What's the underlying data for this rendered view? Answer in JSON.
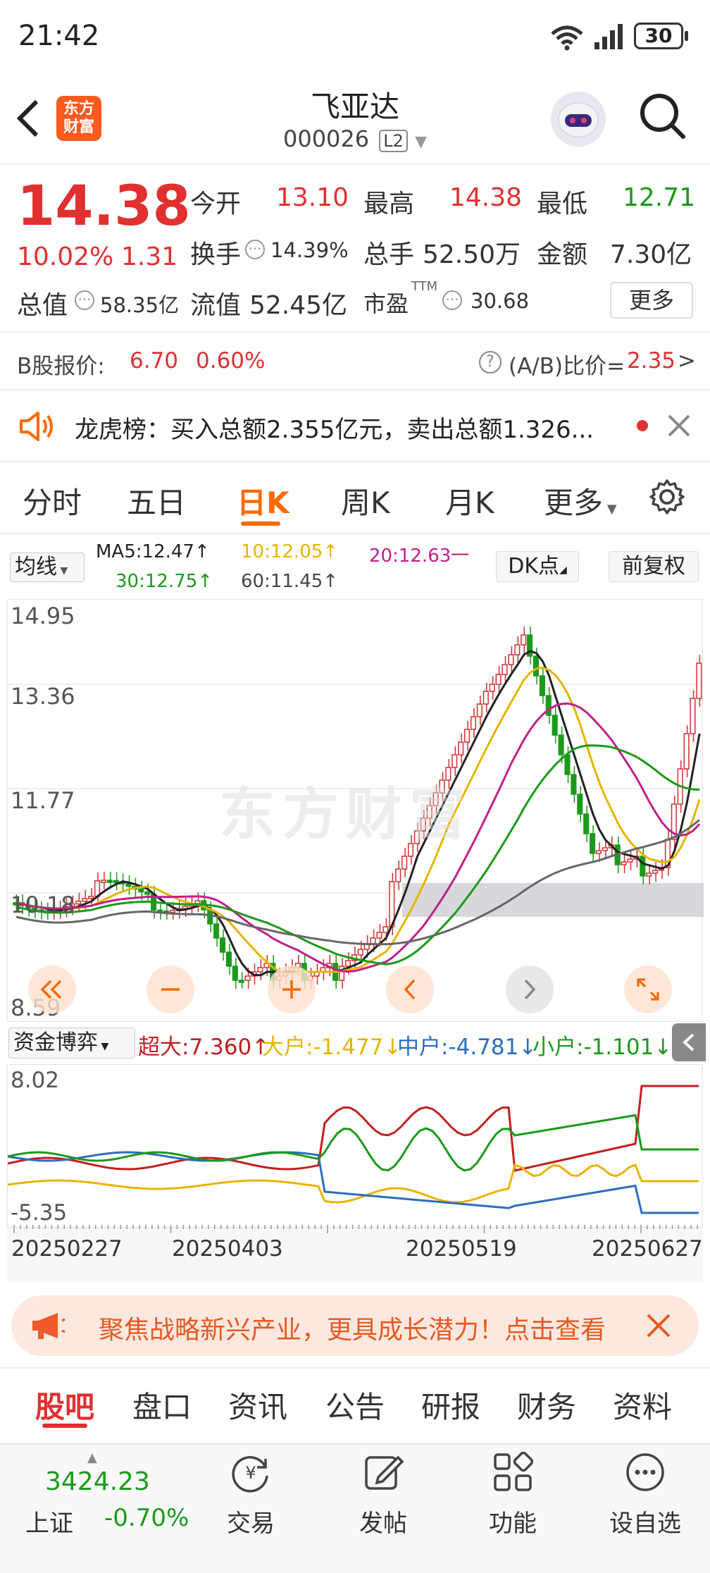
{
  "status": {
    "time": "21:42",
    "battery": "30"
  },
  "header": {
    "name": "飞亚达",
    "code": "000026",
    "level": "L2",
    "logo_top": "东方",
    "logo_bottom": "财富"
  },
  "quote": {
    "price": "14.38",
    "pct": "10.02%",
    "chg": "1.31",
    "open_label": "今开",
    "open": "13.10",
    "high_label": "最高",
    "high": "14.38",
    "low_label": "最低",
    "low": "12.71",
    "turnover_label": "换手",
    "turnover": "14.39%",
    "vol_label": "总手",
    "vol": "52.50万",
    "amt_label": "金额",
    "amt": "7.30亿",
    "mcap_label": "总值",
    "mcap": "58.35亿",
    "float_label": "流值",
    "float": "52.45亿",
    "pe_label": "市盈",
    "pe_sup": "TTM",
    "pe": "30.68",
    "more": "更多"
  },
  "bshare": {
    "label": "B股报价:",
    "price": "6.70",
    "pct": "0.60%",
    "ratio_label": "(A/B)比价=",
    "ratio": "2.35",
    "arrow": ">"
  },
  "notice": {
    "text": "龙虎榜：买入总额2.355亿元，卖出总额1.326..."
  },
  "tabs": [
    "分时",
    "五日",
    "日K",
    "周K",
    "月K",
    "更多"
  ],
  "ma": {
    "selector": "均线",
    "ma5": "MA5:12.47↑",
    "ma10": "10:12.05↑",
    "ma20": "20:12.63一",
    "ma30": "30:12.75↑",
    "ma60": "60:11.45↑",
    "dk": "DK点",
    "adj": "前复权"
  },
  "axis": {
    "y1": "14.95",
    "y2": "13.36",
    "y3": "11.77",
    "y4": "10.18",
    "y5": "8.59",
    "f_top": "8.02",
    "f_bot": "-5.35",
    "d1": "20250227",
    "d2": "20250403",
    "d3": "20250519",
    "d4": "20250627"
  },
  "fund": {
    "selector": "资金博弈",
    "super": "超大:7.360↑",
    "large": "大户:-1.477↓",
    "mid": "中户:-4.781↓",
    "small": "小户:-1.101↓"
  },
  "watermark": "东方财富",
  "promo": {
    "text": "聚焦战略新兴产业，更具成长潜力！点击查看"
  },
  "bottom_tabs": [
    "股吧",
    "盘口",
    "资讯",
    "公告",
    "研报",
    "财务",
    "资料"
  ],
  "nav": {
    "index_value": "3424.23",
    "index_name": "上证",
    "index_pct": "-0.70%",
    "trade": "交易",
    "post": "发帖",
    "func": "功能",
    "watch": "设自选"
  },
  "colors": {
    "up": "#e03030",
    "down": "#1a9a1a",
    "accent": "#ff6a00"
  }
}
